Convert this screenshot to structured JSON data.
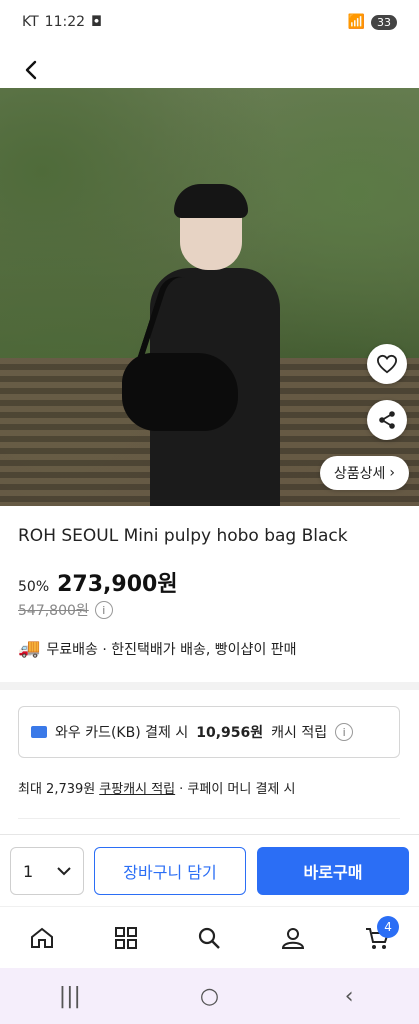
{
  "status_bar": {
    "carrier": "KT",
    "time": "11:22",
    "battery": "33"
  },
  "hero": {
    "detail_label": "상품상세",
    "detail_chevron": "›"
  },
  "product": {
    "title": "ROH SEOUL Mini pulpy hobo bag Black",
    "discount": "50%",
    "price": "273,900원",
    "original_price": "547,800원",
    "shipping": "무료배송 · 한진택배가 배송, 빵이샵이 판매"
  },
  "card_benefit": {
    "prefix": "와우 카드(KB) 결제 시",
    "amount": "10,956원",
    "suffix": "캐시 적립"
  },
  "cash_benefit": {
    "prefix": "최대 2,739원",
    "link": "쿠팡캐시 적립",
    "suffix": "· 쿠페이 머니 결제 시"
  },
  "actions": {
    "quantity": "1",
    "add_to_cart": "장바구니 담기",
    "buy_now": "바로구매"
  },
  "tabbar": {
    "cart_count": "4"
  },
  "colors": {
    "accent": "#2b6ef5"
  }
}
